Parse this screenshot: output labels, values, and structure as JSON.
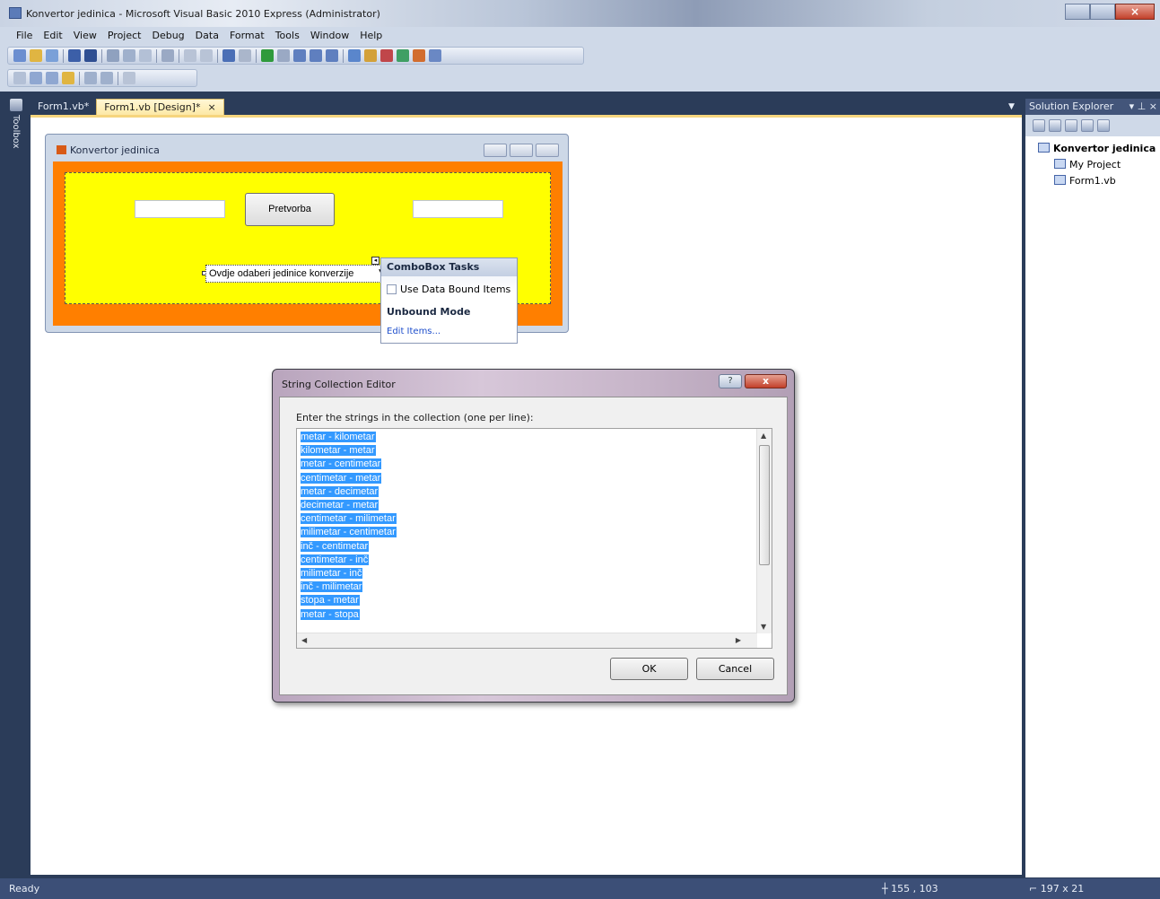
{
  "window": {
    "title": "Konvertor jedinica - Microsoft Visual Basic 2010 Express (Administrator)"
  },
  "menu": [
    "File",
    "Edit",
    "View",
    "Project",
    "Debug",
    "Data",
    "Format",
    "Tools",
    "Window",
    "Help"
  ],
  "toolbox": {
    "label": "Toolbox"
  },
  "tabs": [
    {
      "label": "Form1.vb*"
    },
    {
      "label": "Form1.vb [Design]*",
      "close": "×"
    }
  ],
  "form": {
    "title": "Konvertor jedinica",
    "button_label": "Pretvorba",
    "combo_text": "Ovdje odaberi jedinice konverzije"
  },
  "smart_tag": {
    "title": "ComboBox Tasks",
    "checkbox_label": "Use Data Bound Items",
    "section_label": "Unbound Mode",
    "link_label": "Edit Items..."
  },
  "dialog": {
    "title": "String Collection Editor",
    "help_glyph": "?",
    "close_glyph": "x",
    "prompt": "Enter the strings in the collection (one per line):",
    "items": [
      "metar - kilometar",
      "kilometar - metar",
      "metar - centimetar",
      "centimetar - metar",
      "metar - decimetar",
      "decimetar - metar",
      "centimetar - milimetar",
      "milimetar - centimetar",
      "inč - centimetar",
      "centimetar - inč",
      "milimetar - inč",
      "inč - milimetar",
      "stopa - metar",
      "metar - stopa"
    ],
    "ok_label": "OK",
    "cancel_label": "Cancel"
  },
  "solution_explorer": {
    "title": "Solution Explorer",
    "nodes": [
      {
        "label": "Konvertor jedinica"
      },
      {
        "label": "My Project"
      },
      {
        "label": "Form1.vb"
      }
    ]
  },
  "status": {
    "text": "Ready",
    "position": "155 , 103",
    "size": "197 x 21"
  },
  "colors": {
    "form_back": "#ff7f00",
    "panel_back": "#ffff00",
    "selection": "#3399ff"
  }
}
